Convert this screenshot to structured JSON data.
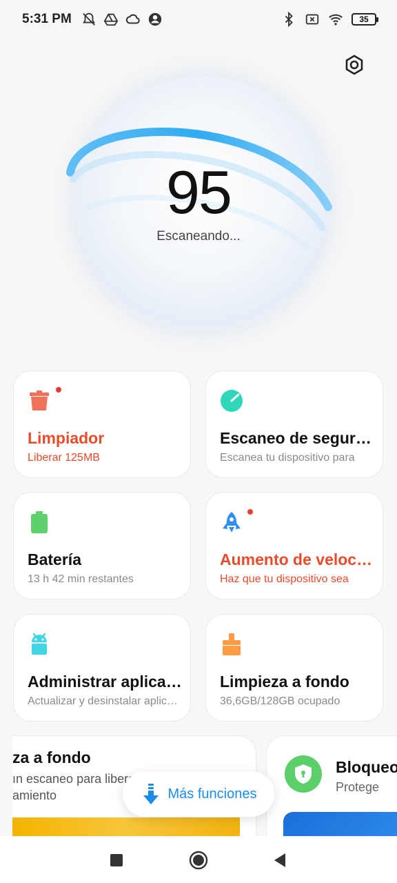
{
  "status_bar": {
    "time": "5:31 PM",
    "battery": "35",
    "icons_left": [
      "notifications-off-icon",
      "drive-icon",
      "cloud-icon",
      "account-circle-icon"
    ],
    "icons_right": [
      "bluetooth-icon",
      "sim-off-icon",
      "wifi-icon",
      "battery-icon"
    ]
  },
  "hero": {
    "score": "95",
    "status": "Escaneando..."
  },
  "cards": [
    {
      "title": "Limpiador",
      "subtitle": "Liberar 125MB",
      "icon": "trash-icon",
      "alert": true,
      "color": "#f2715a"
    },
    {
      "title": "Escaneo de seguridad",
      "subtitle": "Escanea tu dispositivo para",
      "icon": "security-scan-icon",
      "alert": false,
      "color": "#2fd6b8"
    },
    {
      "title": "Batería",
      "subtitle": "13 h 42 min  restantes",
      "icon": "battery-icon",
      "alert": false,
      "color": "#5ed16c"
    },
    {
      "title": "Aumento de velocidad",
      "subtitle": "Haz que tu dispositivo sea",
      "icon": "rocket-icon",
      "alert": true,
      "color": "#2f8ff0"
    },
    {
      "title": "Administrar aplicaciones",
      "subtitle": "Actualizar y desinstalar aplicaciones",
      "icon": "android-icon",
      "alert": false,
      "color": "#3fd7e6"
    },
    {
      "title": "Limpieza a fondo",
      "subtitle": "36,6GB/128GB ocupado",
      "icon": "brush-icon",
      "alert": false,
      "color": "#ff9a45"
    }
  ],
  "promos": {
    "left": {
      "title": "za a fondo",
      "subtitle_line1": "ın escaneo para liberar espacio de",
      "subtitle_line2": "amiento"
    },
    "right": {
      "title": "Bloqueo",
      "subtitle": "Protege"
    }
  },
  "more_button": {
    "label": "Más funciones"
  },
  "colors": {
    "accent": "#1a8cf0",
    "alert": "#e94b2b",
    "hero_ring": "#2aa8f2"
  }
}
